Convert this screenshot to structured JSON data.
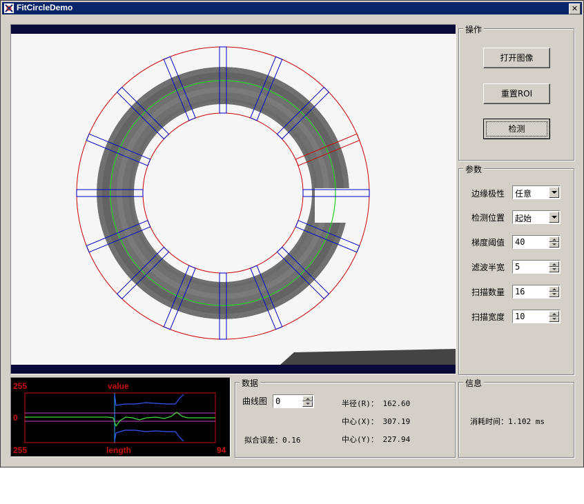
{
  "window": {
    "title": "FitCircleDemo",
    "close_glyph": "✕"
  },
  "operations": {
    "legend": "操作",
    "open_image": "打开图像",
    "reset_roi": "重置ROI",
    "detect": "检测"
  },
  "params": {
    "legend": "参数",
    "edge_polarity_label": "边缘极性",
    "edge_polarity_value": "任意",
    "detect_position_label": "检测位置",
    "detect_position_value": "起始",
    "gradient_threshold_label": "梯度阈值",
    "gradient_threshold_value": "40",
    "filter_half_width_label": "滤波半宽",
    "filter_half_width_value": "5",
    "scan_count_label": "扫描数量",
    "scan_count_value": "16",
    "scan_width_label": "扫描宽度",
    "scan_width_value": "10"
  },
  "curve": {
    "top_left": "255",
    "top_center": "value",
    "mid_left": "0",
    "bottom_left": "255",
    "bottom_center": "length",
    "bottom_right": "94"
  },
  "data_panel": {
    "legend": "数据",
    "curve_label": "曲线图",
    "curve_value": "0",
    "fit_error": "拟合误差：0.16",
    "radius": "半径(R)：  162.60",
    "center_x": "中心(X)：  307.19",
    "center_y": "中心(Y)：  227.94"
  },
  "info_panel": {
    "legend": "信息",
    "elapsed": "消耗时间：1.102 ms"
  },
  "colors": {
    "title_bar": "#0a246a",
    "window_bg": "#d4d0c8",
    "roi_red": "#cc0000",
    "scan_blue": "#0000cc",
    "fit_green": "#22cc22",
    "curve_label_red": "#cc1010"
  },
  "icons": {
    "app_icon": "app-icon",
    "close_icon": "close-icon"
  }
}
